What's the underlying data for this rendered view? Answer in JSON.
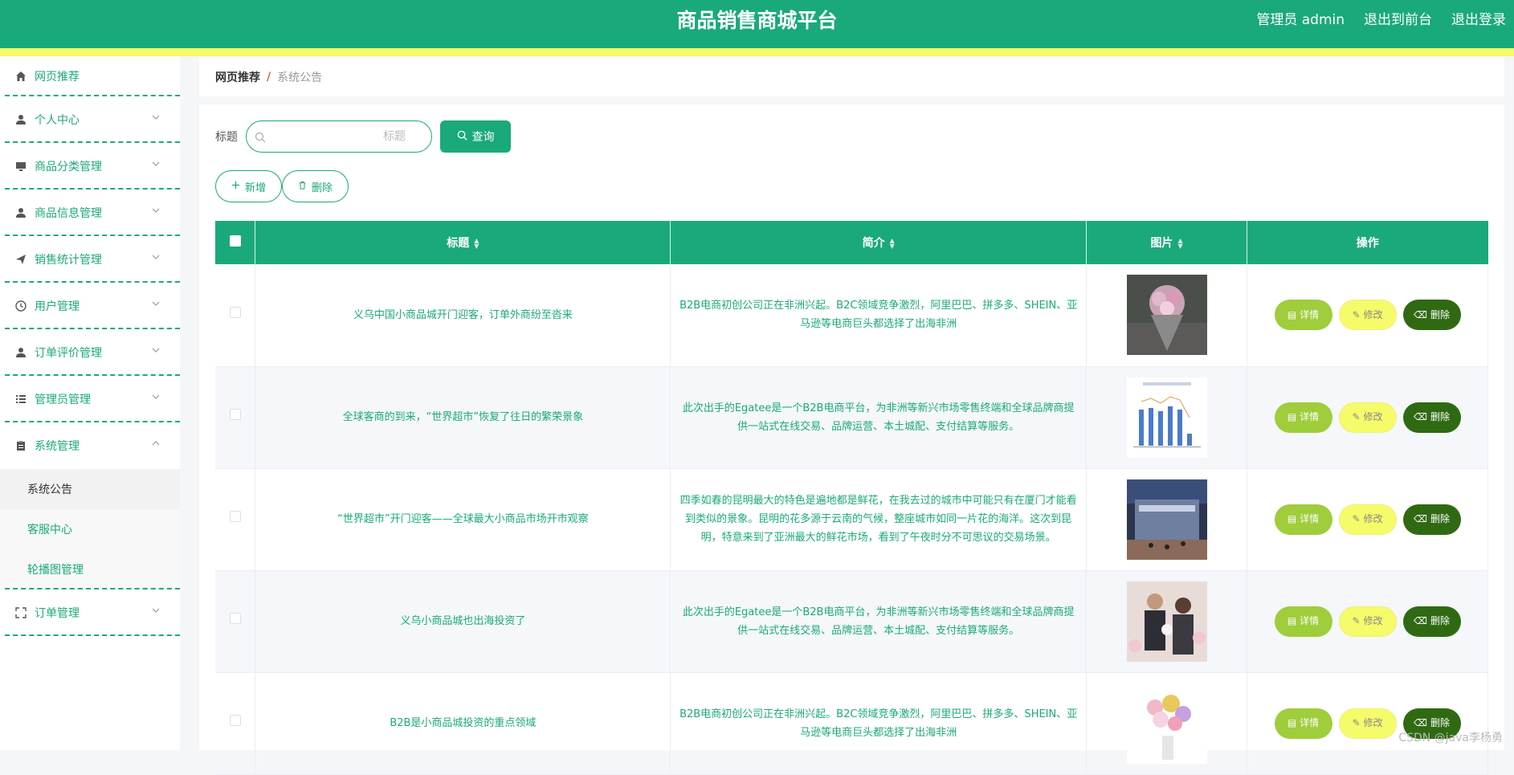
{
  "header": {
    "title": "商品销售商城平台",
    "admin": "管理员 admin",
    "to_front": "退出到前台",
    "logout": "退出登录"
  },
  "sidebar": {
    "items": [
      {
        "label": "网页推荐",
        "icon": "home-icon"
      },
      {
        "label": "个人中心",
        "icon": "user-icon"
      },
      {
        "label": "商品分类管理",
        "icon": "monitor-icon"
      },
      {
        "label": "商品信息管理",
        "icon": "user-icon"
      },
      {
        "label": "销售统计管理",
        "icon": "send-icon"
      },
      {
        "label": "用户管理",
        "icon": "clock-icon"
      },
      {
        "label": "订单评价管理",
        "icon": "user-icon"
      },
      {
        "label": "管理员管理",
        "icon": "list-icon"
      },
      {
        "label": "系统管理",
        "icon": "clipboard-icon"
      },
      {
        "label": "订单管理",
        "icon": "fullscreen-icon"
      }
    ],
    "sub": [
      "系统公告",
      "客服中心",
      "轮播图管理"
    ]
  },
  "breadcrumb": {
    "home": "网页推荐",
    "separator": "/",
    "current": "系统公告"
  },
  "search": {
    "label": "标题",
    "placeholder": "标题",
    "button": "查询"
  },
  "actions": {
    "add": "新增",
    "delete": "删除"
  },
  "table": {
    "columns": [
      "标题",
      "简介",
      "图片",
      "操作"
    ],
    "rows": [
      {
        "title": "义乌中国小商品城开门迎客，订单外商纷至沓来",
        "intro": "B2B电商初创公司正在非洲兴起。B2C领域竞争激烈，阿里巴巴、拼多多、SHEIN、亚马逊等电商巨头都选择了出海非洲",
        "image": "flower-bouquet"
      },
      {
        "title": "全球客商的到来，“世界超市”恢复了往日的繁荣景象",
        "intro": "此次出手的Egatee是一个B2B电商平台，为非洲等新兴市场零售终端和全球品牌商提供一站式在线交易、品牌运营、本土城配、支付结算等服务。",
        "image": "bar-chart"
      },
      {
        "title": "“世界超市”开门迎客——全球最大小商品市场开市观察",
        "intro": "四季如春的昆明最大的特色是遍地都是鲜花，在我去过的城市中可能只有在厦门才能看到类似的景象。昆明的花多源于云南的气候，整座城市如同一片花的海洋。这次到昆明，特意来到了亚洲最大的鲜花市场，看到了午夜时分不可思议的交易场景。",
        "image": "market-building"
      },
      {
        "title": "义乌小商品城也出海投资了",
        "intro": "此次出手的Egatee是一个B2B电商平台，为非洲等新兴市场零售终端和全球品牌商提供一站式在线交易、品牌运营、本土城配、支付结算等服务。",
        "image": "people"
      },
      {
        "title": "B2B是小商品城投资的重点领域",
        "intro": "B2B电商初创公司正在非洲兴起。B2C领域竞争激烈，阿里巴巴、拼多多、SHEIN、亚马逊等电商巨头都选择了出海非洲",
        "image": "flower-vase"
      }
    ],
    "ops": {
      "detail": "详情",
      "edit": "修改",
      "del": "删除"
    }
  },
  "watermark": "CSDN @java李杨勇",
  "colors": {
    "primary": "#1aa97b",
    "accent_yellow": "#f6fb6a",
    "detail": "#9fcd3b",
    "delete": "#2f6a13"
  }
}
